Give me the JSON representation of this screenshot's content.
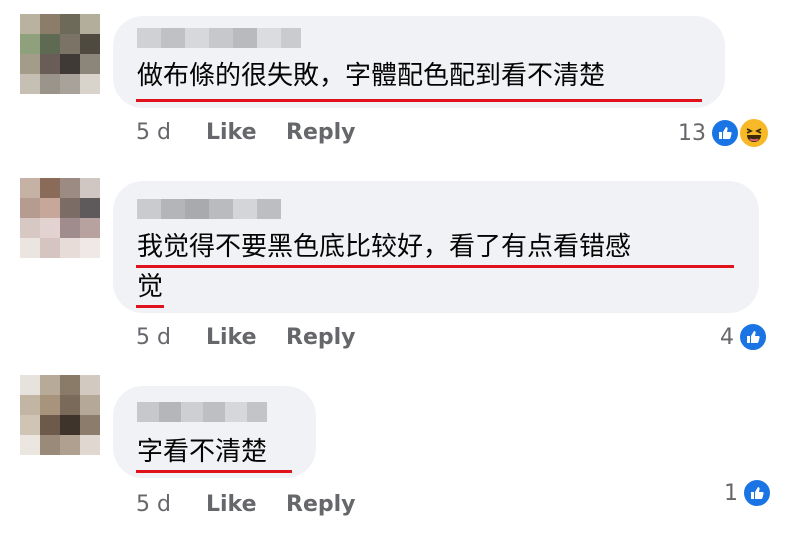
{
  "comments": [
    {
      "author": "",
      "text_lines": [
        "做布條的很失敗，字體配色配到看不清楚"
      ],
      "time": "5 d",
      "like_label": "Like",
      "reply_label": "Reply",
      "reaction_count": "13",
      "reactions": [
        "like-icon",
        "haha-icon"
      ]
    },
    {
      "author": "",
      "text_lines": [
        "我觉得不要黑色底比较好，看了有点看错感",
        "觉"
      ],
      "time": "5 d",
      "like_label": "Like",
      "reply_label": "Reply",
      "reaction_count": "4",
      "reactions": [
        "like-icon"
      ]
    },
    {
      "author": "",
      "text_lines": [
        "字看不清楚"
      ],
      "time": "5 d",
      "like_label": "Like",
      "reply_label": "Reply",
      "reaction_count": "1",
      "reactions": [
        "like-icon"
      ]
    }
  ],
  "colors": {
    "bubble": "#f0f2f5",
    "underline": "#e0121c",
    "meta": "#65676b",
    "like_blue": "#1b74e4",
    "haha_yellow": "#f7b928"
  }
}
